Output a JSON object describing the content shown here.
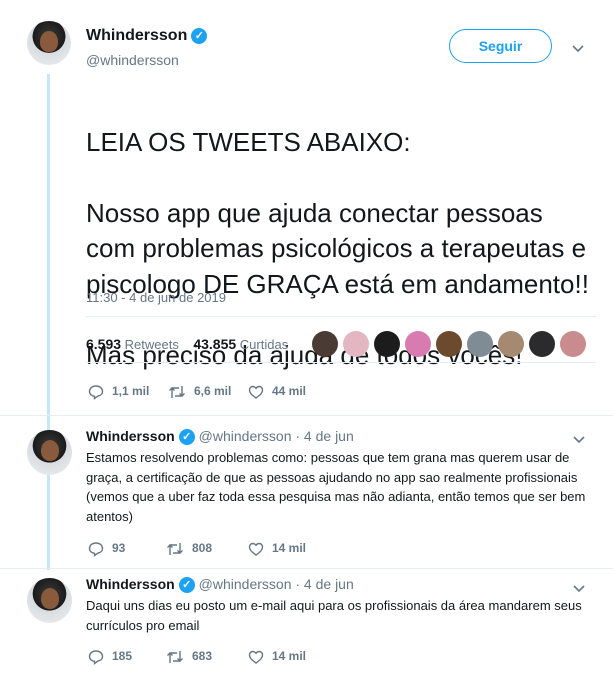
{
  "author": {
    "name": "Whindersson",
    "handle": "@whindersson"
  },
  "follow_label": "Seguir",
  "main_tweet": {
    "lines": [
      "LEIA OS TWEETS ABAIXO:",
      "Nosso app que ajuda conectar pessoas com problemas psicológicos a terapeutas e piscologo DE GRAÇA está em andamento!!",
      "Mas preciso da ajuda de todos vocês!"
    ],
    "timestamp": "11:30 - 4 de jun de 2019",
    "retweets_count": "6.593",
    "retweets_label": "Retweets",
    "likes_count": "43.855",
    "likes_label": "Curtidas",
    "actions": {
      "replies": "1,1 mil",
      "retweets": "6,6 mil",
      "likes": "44 mil"
    }
  },
  "replies": [
    {
      "name": "Whindersson",
      "handle": "@whindersson",
      "date": "· 4 de jun",
      "text": "Estamos resolvendo problemas como: pessoas que tem grana mas querem usar de graça, a certificação de que as pessoas ajudando no app sao realmente profissionais (vemos que a uber faz toda essa pesquisa mas não adianta, então temos que ser bem atentos)",
      "actions": {
        "replies": "93",
        "retweets": "808",
        "likes": "14 mil"
      }
    },
    {
      "name": "Whindersson",
      "handle": "@whindersson",
      "date": "· 4 de jun",
      "text": "Daqui uns dias eu posto um e-mail aqui para os profissionais da área mandarem seus currículos pro email",
      "actions": {
        "replies": "185",
        "retweets": "683",
        "likes": "14 mil"
      }
    }
  ],
  "colors": {
    "accent": "#1da1f2",
    "muted": "#657786",
    "text": "#14171a"
  }
}
